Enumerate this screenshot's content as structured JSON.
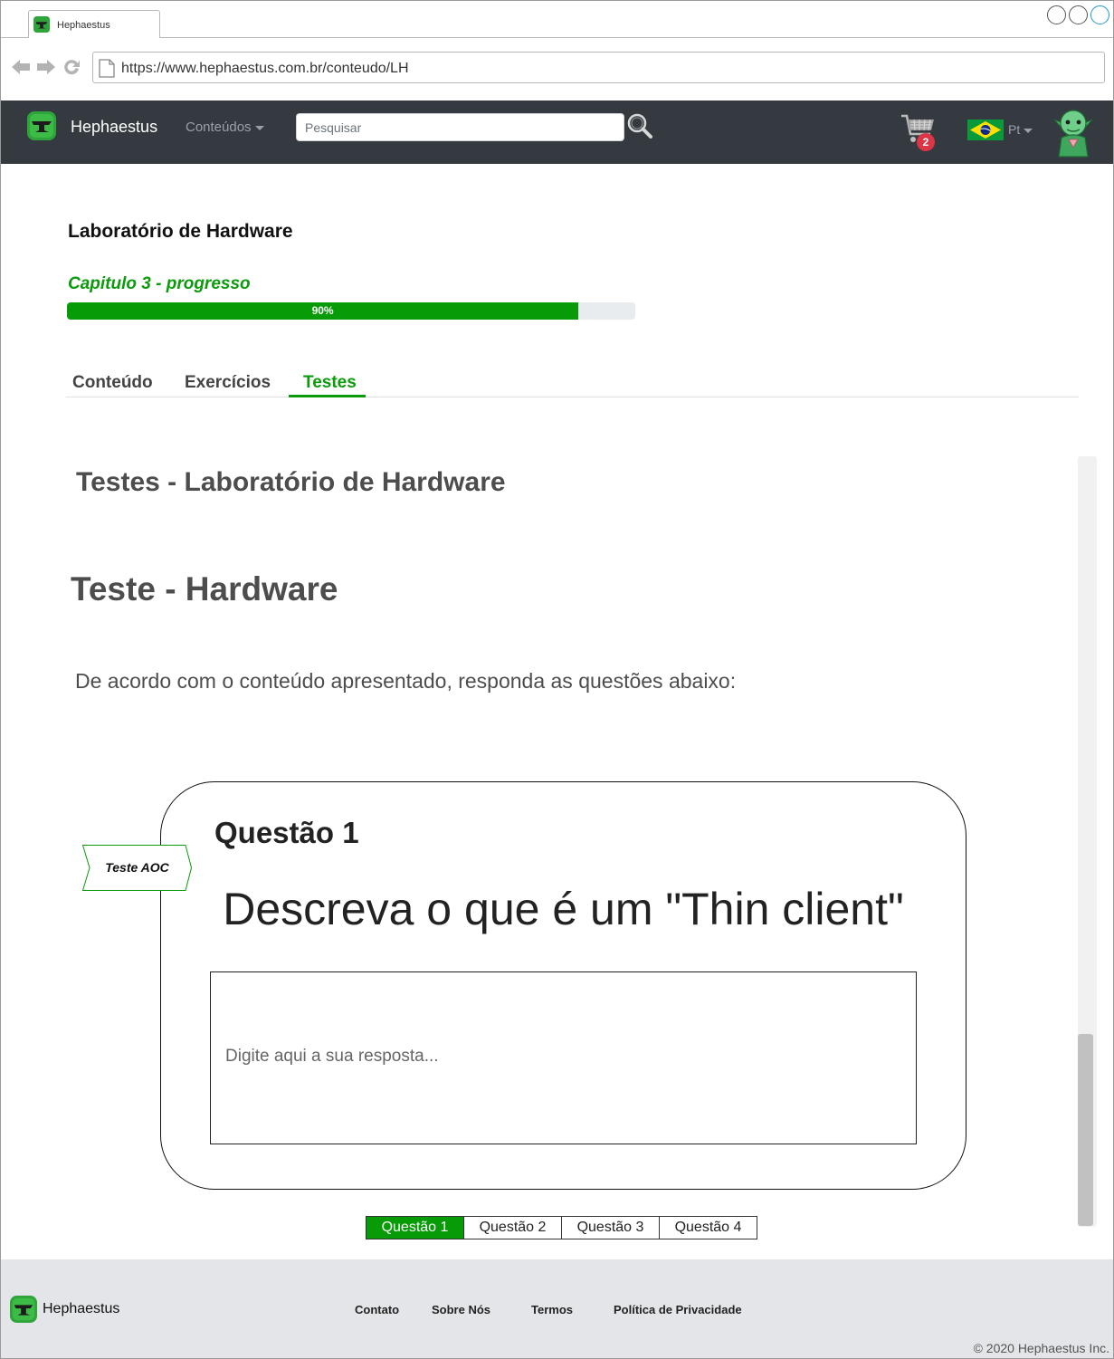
{
  "browser": {
    "tab_title": "Hephaestus",
    "url": "https://www.hephaestus.com.br/conteudo/LH"
  },
  "navbar": {
    "brand": "Hephaestus",
    "menu_label": "Conteúdos",
    "search_placeholder": "Pesquisar",
    "cart_count": "2",
    "language": "Pt",
    "colors": {
      "background": "#343a40",
      "badge": "#dc3545"
    }
  },
  "course": {
    "title": "Laboratório de Hardware",
    "progress_label": "Capitulo 3 - progresso",
    "progress_percent": 90,
    "progress_text": "90%"
  },
  "tabs": [
    {
      "label": "Conteúdo",
      "active": false
    },
    {
      "label": "Exercícios",
      "active": false
    },
    {
      "label": "Testes",
      "active": true
    }
  ],
  "main": {
    "section_title": "Testes - Laboratório de Hardware",
    "test_title": "Teste - Hardware",
    "instructions": "De acordo com o conteúdo apresentado, responda as questões abaixo:",
    "question": {
      "tag": "Teste AOC",
      "number": "Questão 1",
      "text": "Descreva o que é um \"Thin client\"",
      "answer_placeholder": "Digite aqui a sua resposta...",
      "answer_value": ""
    },
    "pager": [
      {
        "label": "Questão 1",
        "active": true
      },
      {
        "label": "Questão 2",
        "active": false
      },
      {
        "label": "Questão 3",
        "active": false
      },
      {
        "label": "Questão 4",
        "active": false
      }
    ]
  },
  "footer": {
    "brand": "Hephaestus",
    "links": [
      "Contato",
      "Sobre Nós",
      "Termos",
      "Política de Privacidade"
    ],
    "copyright": "© 2020 Hephaestus Inc."
  },
  "theme": {
    "accent": "#079b07",
    "text_muted": "#4d4d4d"
  }
}
